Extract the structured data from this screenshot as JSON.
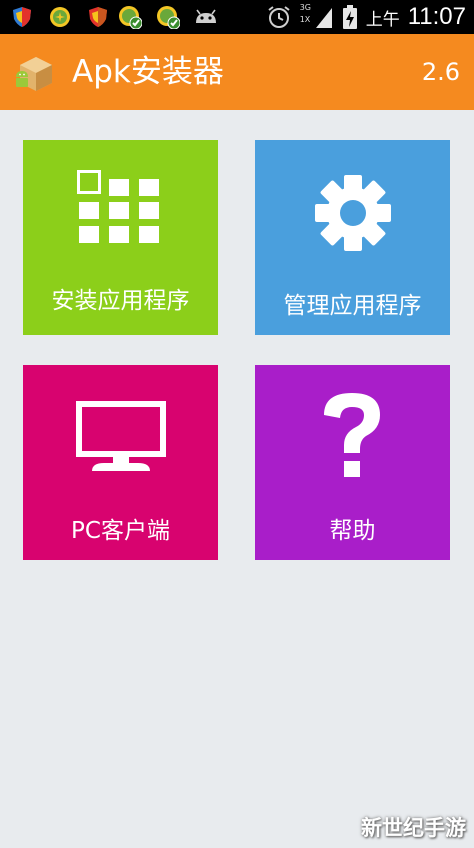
{
  "status_bar": {
    "network_label": "3G",
    "network_sub": "1X",
    "period": "上午",
    "time": "11:07"
  },
  "app": {
    "title": "Apk安装器",
    "version": "2.6"
  },
  "tiles": [
    {
      "label": "安装应用程序",
      "color": "#8ccf1a",
      "icon": "grid-apps-icon"
    },
    {
      "label": "管理应用程序",
      "color": "#4a9fdd",
      "icon": "gear-icon"
    },
    {
      "label": "PC客户端",
      "color": "#d8036f",
      "icon": "monitor-icon"
    },
    {
      "label": "帮助",
      "color": "#a91ec9",
      "icon": "question-mark-icon"
    }
  ],
  "watermark": "新世纪手游",
  "colors": {
    "title_bar": "#f58a1f",
    "background": "#e8ebee",
    "status_bar": "#000000"
  }
}
